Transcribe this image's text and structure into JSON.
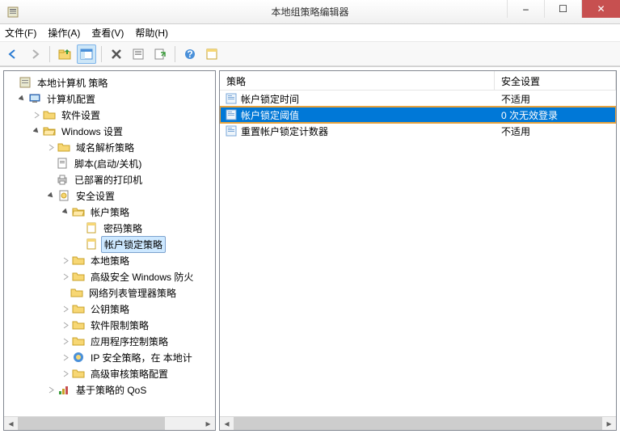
{
  "window": {
    "title": "本地组策略编辑器",
    "controls": {
      "min": "–",
      "max": "☐",
      "close": "✕"
    }
  },
  "menu": {
    "file": "文件(F)",
    "action": "操作(A)",
    "view": "查看(V)",
    "help": "帮助(H)"
  },
  "tree": {
    "root": "本地计算机 策略",
    "computer_config": "计算机配置",
    "software_settings": "软件设置",
    "windows_settings": "Windows 设置",
    "name_resolution": "域名解析策略",
    "scripts": "脚本(启动/关机)",
    "printers": "已部署的打印机",
    "security_settings": "安全设置",
    "account_policies": "帐户策略",
    "password_policy": "密码策略",
    "account_lockout": "帐户锁定策略",
    "local_policies": "本地策略",
    "firewall": "高级安全 Windows 防火",
    "network_list": "网络列表管理器策略",
    "public_key": "公钥策略",
    "software_restriction": "软件限制策略",
    "app_control": "应用程序控制策略",
    "ip_security": "IP 安全策略，在 本地计",
    "advanced_audit": "高级审核策略配置",
    "qos": "基于策略的 QoS"
  },
  "list": {
    "col_policy": "策略",
    "col_setting": "安全设置",
    "rows": [
      {
        "policy": "帐户锁定时间",
        "setting": "不适用",
        "selected": false
      },
      {
        "policy": "帐户锁定阈值",
        "setting": "0 次无效登录",
        "selected": true
      },
      {
        "policy": "重置帐户锁定计数器",
        "setting": "不适用",
        "selected": false
      }
    ]
  }
}
